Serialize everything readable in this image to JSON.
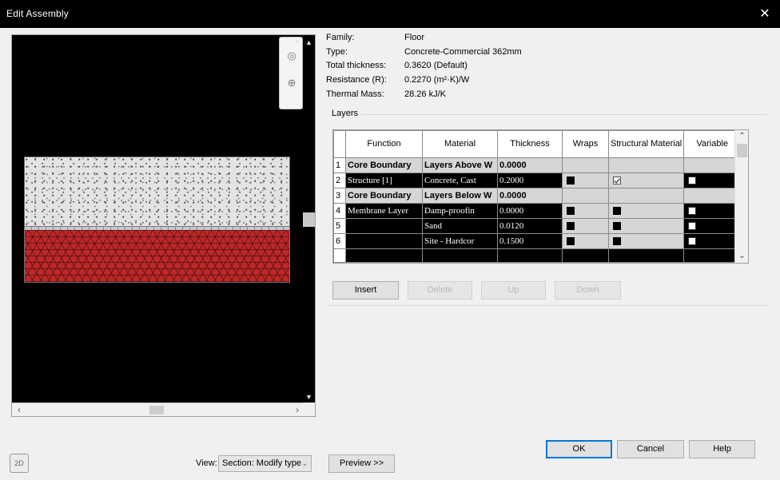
{
  "window": {
    "title": "Edit Assembly",
    "close_glyph": "✕"
  },
  "properties": [
    {
      "label": "Family:",
      "value": "Floor"
    },
    {
      "label": "Type:",
      "value": "Concrete-Commercial 362mm"
    },
    {
      "label": "Total thickness:",
      "value": "0.3620 (Default)"
    },
    {
      "label": "Resistance (R):",
      "value": "0.2270 (m²·K)/W"
    },
    {
      "label": "Thermal Mass:",
      "value": "28.26 kJ/K"
    }
  ],
  "layers_title": "Layers",
  "grid": {
    "headers": {
      "function": "Function",
      "material": "Material",
      "thickness": "Thickness",
      "wraps": "Wraps",
      "structural": "Structural Material",
      "variable": "Variable"
    },
    "rows": [
      {
        "num": "1",
        "function": "Core Boundary",
        "material": "Layers Above W",
        "thickness": "0.0000"
      },
      {
        "num": "2",
        "function": "Structure [1]",
        "material": "Concrete, Cast",
        "thickness": "0.2000"
      },
      {
        "num": "3",
        "function": "Core Boundary",
        "material": "Layers Below W",
        "thickness": "0.0000"
      },
      {
        "num": "4",
        "function": "Membrane Layer",
        "material": "Damp-proofin",
        "thickness": "0.0000"
      },
      {
        "num": "5",
        "function": "",
        "material": "Sand",
        "thickness": "0.0120"
      },
      {
        "num": "6",
        "function": "",
        "material": "Site - Hardcor",
        "thickness": "0.1500"
      }
    ]
  },
  "buttons": {
    "insert": "Insert",
    "delete": "Delete",
    "up": "Up",
    "down": "Down",
    "ok": "OK",
    "cancel": "Cancel",
    "help": "Help",
    "preview": "Preview >>"
  },
  "view": {
    "label": "View:",
    "value": "Section: Modify type"
  },
  "colors": {
    "title_bar": "#000000",
    "hardcore": "#c02828",
    "concrete": "#e3e3e3",
    "accent": "#0078d7"
  }
}
